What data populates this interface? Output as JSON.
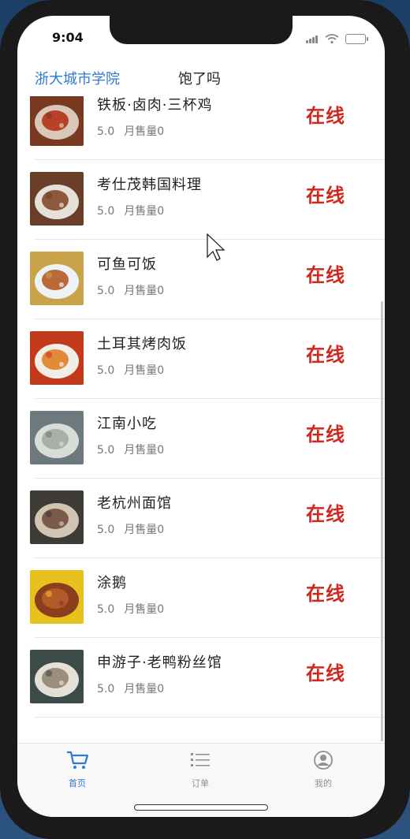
{
  "status_bar": {
    "time": "9:04"
  },
  "nav": {
    "left_label": "浙大城市学院",
    "title": "饱了吗"
  },
  "restaurants": [
    {
      "name": "铁板·卤肉·三杯鸡",
      "rating": "5.0",
      "sales": "月售量0",
      "status": "在线",
      "thumb": [
        "#7a3a22",
        "#d9c8b8",
        "#b8412a"
      ]
    },
    {
      "name": "考仕茂韩国料理",
      "rating": "5.0",
      "sales": "月售量0",
      "status": "在线",
      "thumb": [
        "#6a3f2a",
        "#e7e0d8",
        "#8c5a3a"
      ]
    },
    {
      "name": "可鱼可饭",
      "rating": "5.0",
      "sales": "月售量0",
      "status": "在线",
      "thumb": [
        "#c9a24a",
        "#eef2f5",
        "#b86a3a"
      ]
    },
    {
      "name": "土耳其烤肉饭",
      "rating": "5.0",
      "sales": "月售量0",
      "status": "在线",
      "thumb": [
        "#c23a1c",
        "#f2ede6",
        "#e08a3a"
      ]
    },
    {
      "name": "江南小吃",
      "rating": "5.0",
      "sales": "月售量0",
      "status": "在线",
      "thumb": [
        "#6c7a7e",
        "#d9dcd7",
        "#a9b0a8"
      ]
    },
    {
      "name": "老杭州面馆",
      "rating": "5.0",
      "sales": "月售量0",
      "status": "在线",
      "thumb": [
        "#3e3a36",
        "#cfc5b2",
        "#7b5a4a"
      ]
    },
    {
      "name": "涂鹅",
      "rating": "5.0",
      "sales": "月售量0",
      "status": "在线",
      "thumb": [
        "#e7c21f",
        "#8a3e1e",
        "#b25a2a"
      ]
    },
    {
      "name": "申游子·老鸭粉丝馆",
      "rating": "5.0",
      "sales": "月售量0",
      "status": "在线",
      "thumb": [
        "#3c4a4a",
        "#e4e0d6",
        "#9a8f7a"
      ]
    }
  ],
  "tabs": [
    {
      "label": "首页",
      "icon": "cart-icon",
      "active": true
    },
    {
      "label": "订单",
      "icon": "list-icon",
      "active": false
    },
    {
      "label": "我的",
      "icon": "profile-icon",
      "active": false
    }
  ],
  "colors": {
    "accent": "#2f7ad1",
    "status_online": "#d0271f"
  }
}
